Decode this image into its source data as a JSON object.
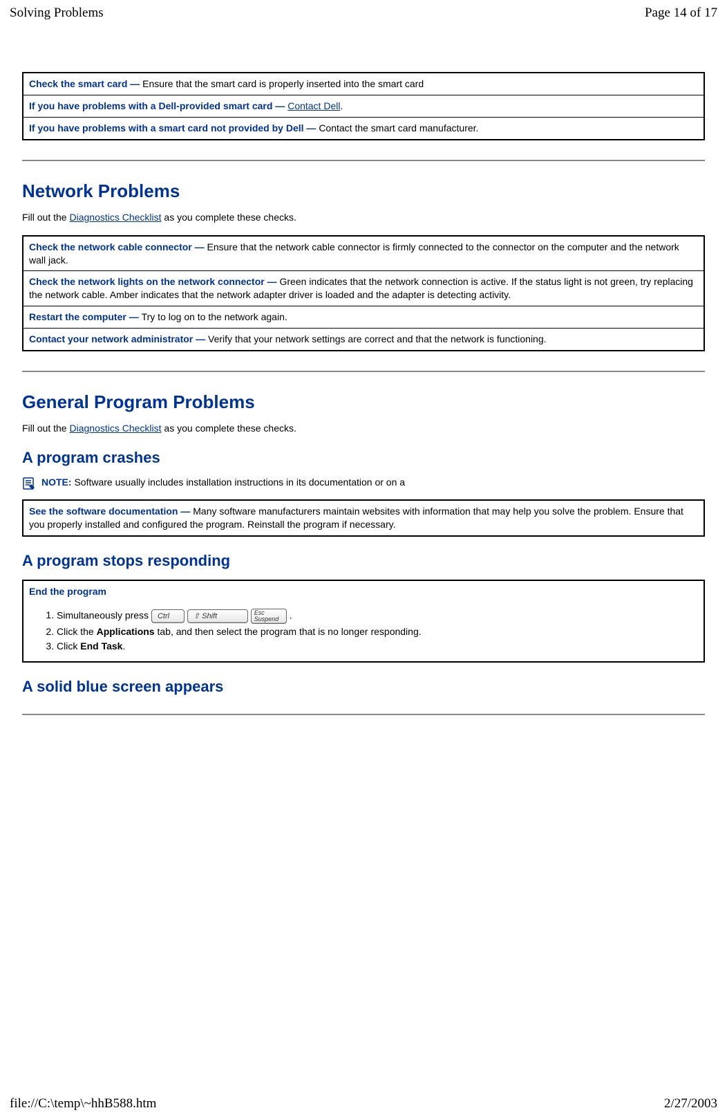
{
  "header": {
    "title": "Solving Problems",
    "pageinfo": "Page 14 of 17"
  },
  "footer": {
    "path": "file://C:\\temp\\~hhB588.htm",
    "date": "2/27/2003"
  },
  "smartcard": {
    "row1": {
      "bold": "Check the smart card — ",
      "rest": "Ensure that the smart card is properly inserted into the smart card"
    },
    "row2": {
      "bold": "If you have problems with a Dell-provided smart card — ",
      "link": "Contact Dell",
      "after": "."
    },
    "row3": {
      "bold": "If you have problems with a smart card not provided by Dell — ",
      "rest": "Contact the smart card manufacturer."
    }
  },
  "network": {
    "heading": "Network Problems",
    "intro_pre": "Fill out the ",
    "intro_link": "Diagnostics Checklist",
    "intro_post": " as you complete these checks.",
    "row1": {
      "bold": "Check the network cable connector — ",
      "rest": "Ensure that the network cable connector is firmly connected to the connector on the computer and the network wall jack."
    },
    "row2": {
      "bold": "Check the network lights on the network connector — ",
      "rest": "Green indicates that the network connection is active. If the status light is not green, try replacing the network cable. Amber indicates that the network adapter driver is loaded and the adapter is detecting activity."
    },
    "row3": {
      "bold": "Restart the computer — ",
      "rest": "Try to log on to the network again."
    },
    "row4": {
      "bold": "Contact your network administrator — ",
      "rest": "Verify that your network settings are correct and that the network is functioning."
    }
  },
  "general": {
    "heading": "General Program Problems",
    "intro_pre": "Fill out the ",
    "intro_link": "Diagnostics Checklist",
    "intro_post": " as you complete these checks.",
    "crash_heading": "A program crashes",
    "note_bold": "NOTE: ",
    "note_rest": "Software usually includes installation instructions in its documentation or on a",
    "doc_row": {
      "bold": "See the software documentation — ",
      "rest": "Many software manufacturers maintain websites with information that may help you solve the problem. Ensure that you properly installed and configured the program. Reinstall the program if necessary."
    },
    "stops_heading": "A program stops responding",
    "end_heading": "End the program",
    "step1_pre": "Simultaneously press ",
    "key_ctrl": "Ctrl",
    "key_shift": "Shift",
    "key_esc1": "Esc",
    "key_esc2": "Suspend",
    "step1_post": " .",
    "step2_pre": "Click the ",
    "step2_bold": "Applications",
    "step2_post": " tab, and then select the program that is no longer responding.",
    "step3_pre": "Click ",
    "step3_bold": "End Task",
    "step3_post": ".",
    "blue_heading": "A solid blue screen appears"
  }
}
